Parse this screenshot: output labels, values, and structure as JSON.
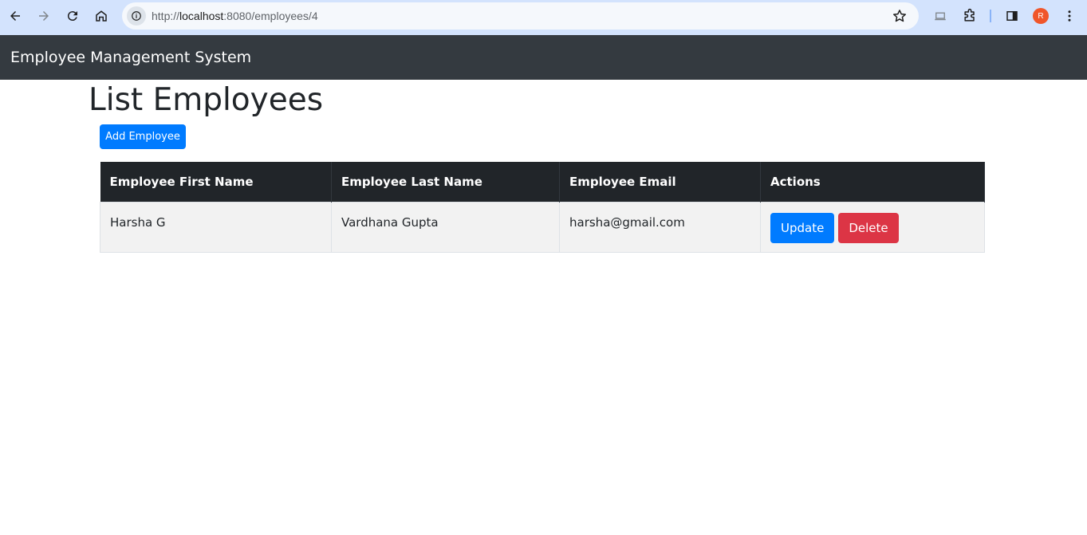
{
  "browser": {
    "url_scheme": "http://",
    "url_host": "localhost",
    "url_rest": ":8080/employees/4",
    "avatar_letter": "R"
  },
  "app": {
    "title": "Employee Management System"
  },
  "page": {
    "title": "List Employees",
    "add_button": "Add Employee"
  },
  "table": {
    "headers": [
      "Employee First Name",
      "Employee Last Name",
      "Employee Email",
      "Actions"
    ],
    "rows": [
      {
        "first_name": "Harsha G",
        "last_name": "Vardhana Gupta",
        "email": "harsha@gmail.com",
        "update_label": "Update",
        "delete_label": "Delete"
      }
    ]
  },
  "colors": {
    "primary": "#007bff",
    "danger": "#dc3545",
    "navbar": "#343a40",
    "table_header": "#212529"
  }
}
